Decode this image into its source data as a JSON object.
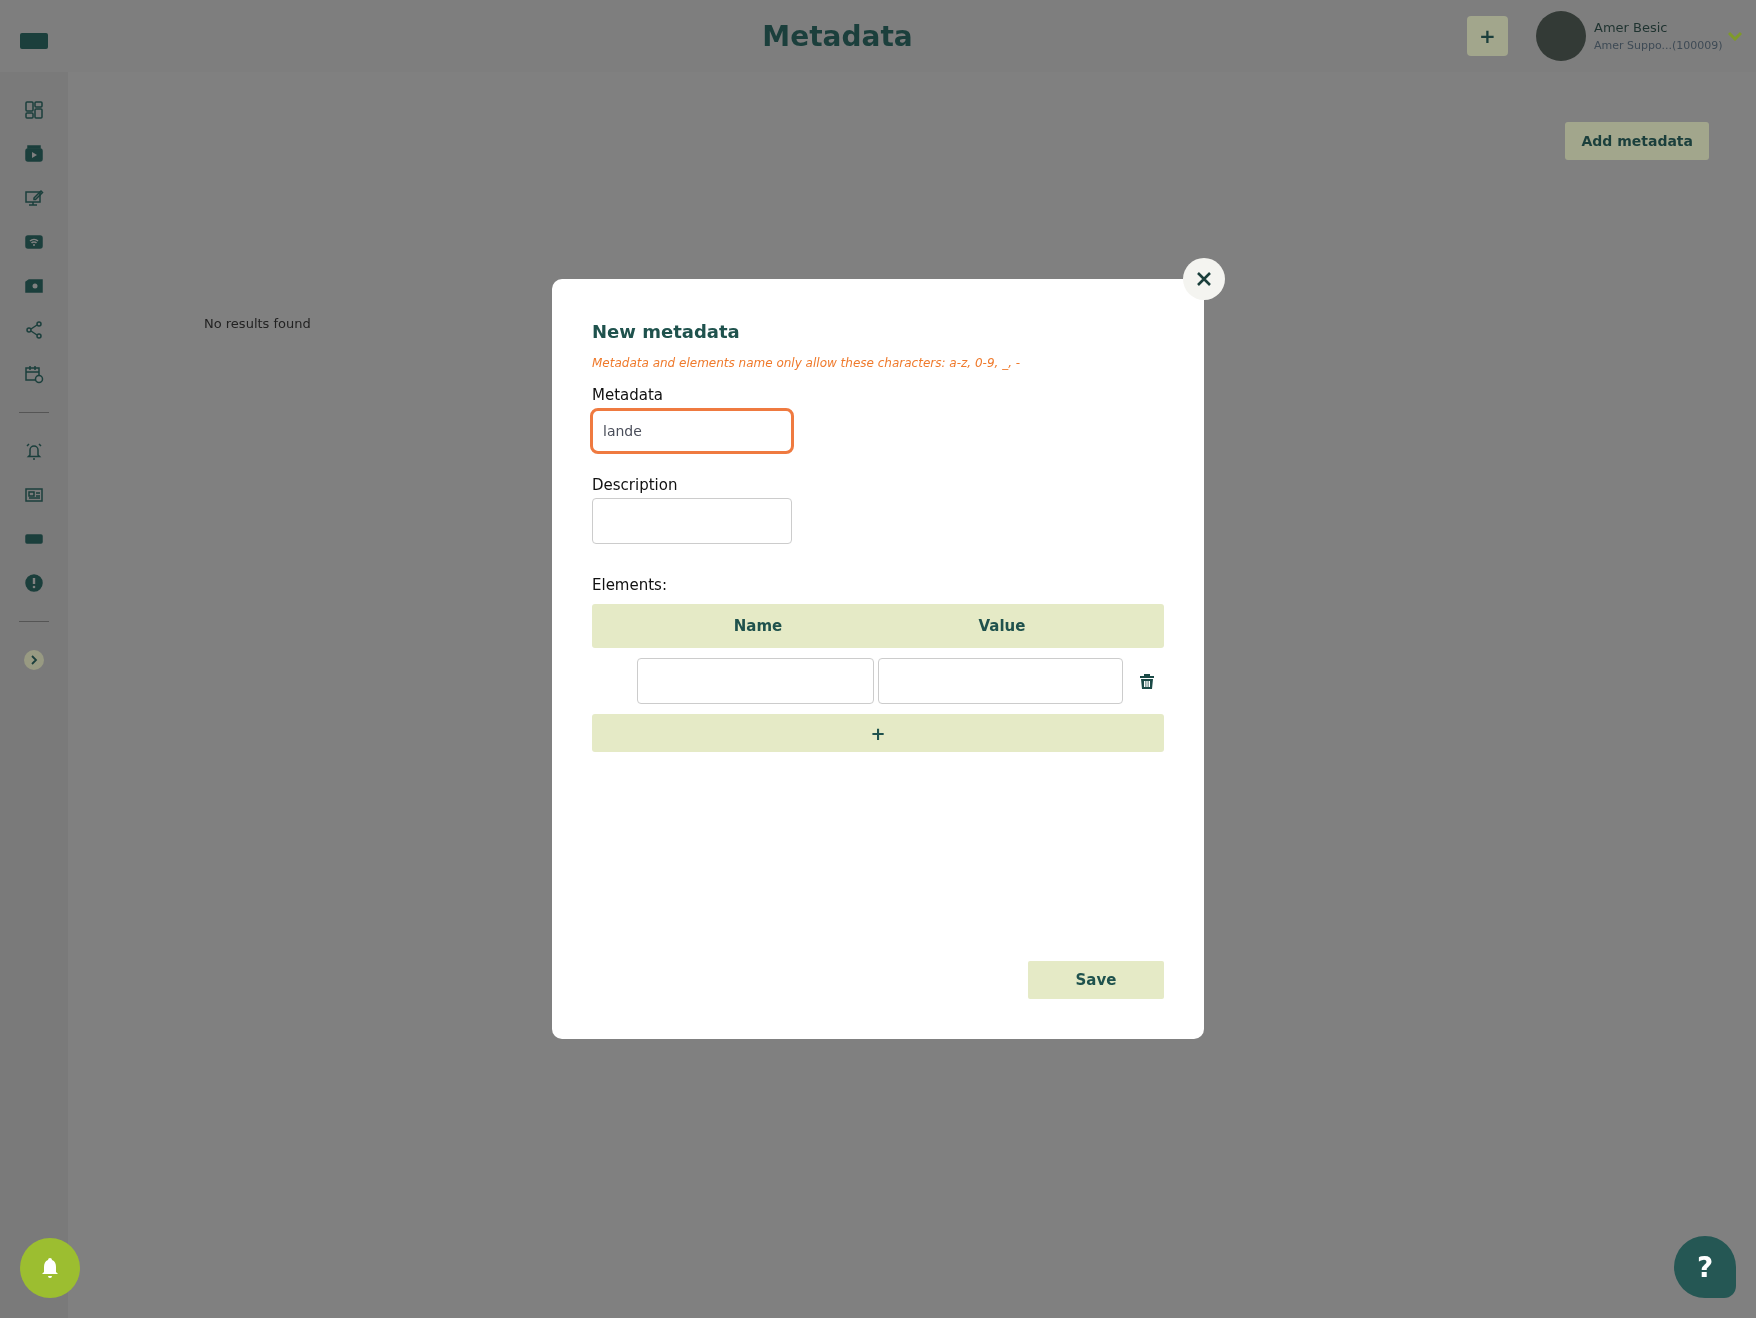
{
  "header": {
    "title": "Metadata",
    "add_button": "+",
    "user": {
      "name": "Amer Besic",
      "subtitle": "Amer Suppo...(100009)"
    }
  },
  "toolbar": {
    "add_button": "Add metadata"
  },
  "empty_message": "No results found",
  "modal": {
    "title": "New metadata",
    "hint": "Metadata and elements name only allow these characters: a-z, 0-9, _, -",
    "fields": [
      {
        "label": "Metadata",
        "value": "lande",
        "focused": true
      },
      {
        "label": "Description",
        "focused": false
      }
    ],
    "elements_label": "Elements:",
    "columns": [
      "Name",
      "Value"
    ],
    "rows": [
      {
        "kind": "input"
      }
    ],
    "add_row_button": "+",
    "save_button": "Save"
  },
  "help_button": "?"
}
